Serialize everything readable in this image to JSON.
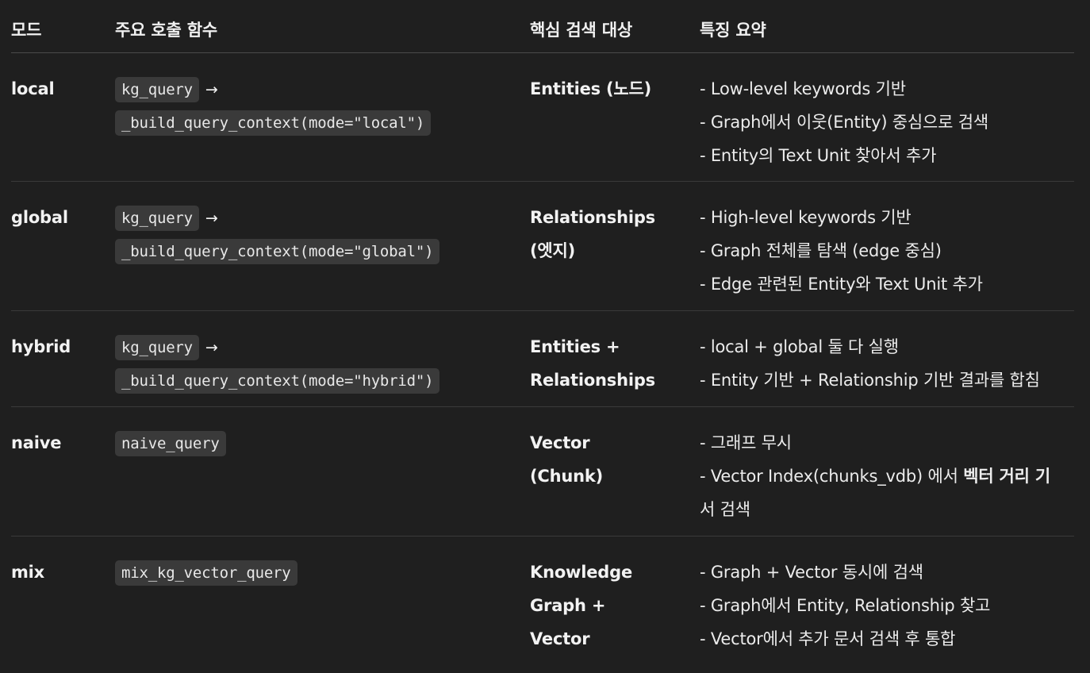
{
  "headers": {
    "mode": "모드",
    "func": "주요 호출 함수",
    "target": "핵심 검색 대상",
    "summary": "특징 요약"
  },
  "arrow": "→",
  "rows": [
    {
      "mode": "local",
      "func1": "kg_query",
      "func2": "_build_query_context(mode=\"local\")",
      "target": [
        "Entities (노드)"
      ],
      "desc": [
        "- Low-level keywords 기반",
        "- Graph에서 이웃(Entity) 중심으로 검색",
        "- Entity의 Text Unit 찾아서 추가"
      ]
    },
    {
      "mode": "global",
      "func1": "kg_query",
      "func2": "_build_query_context(mode=\"global\")",
      "target": [
        "Relationships",
        "(엣지)"
      ],
      "desc": [
        "- High-level keywords 기반",
        "- Graph 전체를 탐색 (edge 중심)",
        "- Edge 관련된 Entity와 Text Unit 추가"
      ]
    },
    {
      "mode": "hybrid",
      "func1": "kg_query",
      "func2": "_build_query_context(mode=\"hybrid\")",
      "target": [
        "Entities +",
        "Relationships"
      ],
      "desc": [
        "- local + global 둘 다 실행",
        "- Entity 기반 + Relationship 기반 결과를 합침"
      ]
    },
    {
      "mode": "naive",
      "func1": "naive_query",
      "target": [
        "Vector",
        "(Chunk)"
      ],
      "desc1": "- 그래프 무시",
      "desc2_pre": "- Vector Index(chunks_vdb) 에서 ",
      "desc2_bold": "벡터 거리 기",
      "desc3": "서 검색"
    },
    {
      "mode": "mix",
      "func1": "mix_kg_vector_query",
      "target": [
        "Knowledge",
        "Graph +",
        "Vector"
      ],
      "desc": [
        "- Graph + Vector 동시에 검색",
        "- Graph에서 Entity, Relationship 찾고",
        "- Vector에서 추가 문서 검색 후 통합"
      ]
    }
  ]
}
